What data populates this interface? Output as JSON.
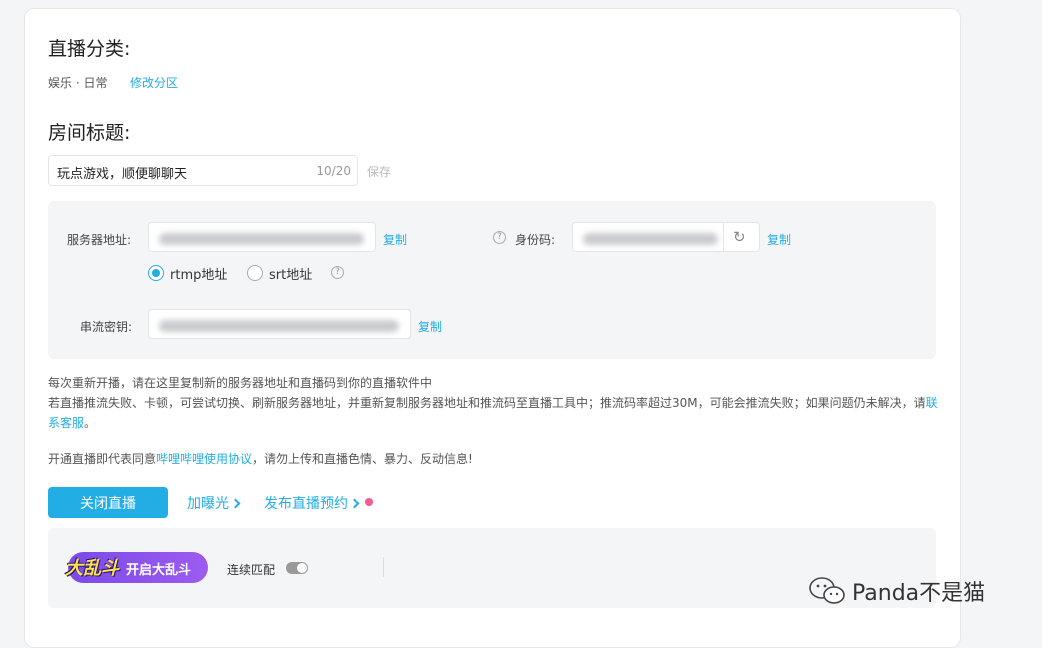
{
  "category": {
    "title": "直播分类:",
    "value": "娱乐 · 日常",
    "change_link": "修改分区"
  },
  "room_title": {
    "title": "房间标题:",
    "input_value": "玩点游戏，顺便聊聊天",
    "counter": "10/20",
    "save_label": "保存"
  },
  "stream": {
    "server_label": "服务器地址:",
    "server_copy": "复制",
    "idcode_label": "身份码:",
    "idcode_copy": "复制",
    "protocol_rtmp": "rtmp地址",
    "protocol_srt": "srt地址",
    "protocol_selected": "rtmp地址",
    "key_label": "串流密钥:",
    "key_copy": "复制"
  },
  "notes": {
    "line1": "每次重新开播，请在这里复制新的服务器地址和直播码到你的直播软件中",
    "line2_text": "若直播推流失败、卡顿，可尝试切换、刷新服务器地址，并重新复制服务器地址和推流码至直播工具中；推流码率超过30M，可能会推流失败；如果问题仍未解决，请",
    "line2_link_a": "联",
    "line2_link_b": "系客服",
    "line2_end": "。"
  },
  "agreement": {
    "prefix": "开通直播即代表同意",
    "link": "哔哩哔哩使用协议",
    "suffix": "，请勿上传和直播色情、暴力、反动信息!"
  },
  "actions": {
    "close_live": "关闭直播",
    "boost": "加曝光",
    "schedule": "发布直播预约"
  },
  "brawl": {
    "logo_text": "大乱斗",
    "button_text": "开启大乱斗",
    "continuous_label": "连续匹配",
    "continuous_on": false
  },
  "watermark": {
    "text": "Panda不是猫"
  },
  "colors": {
    "accent": "#23ade5",
    "badge_dot": "#f25d8e",
    "brawl_purple": "#8a52ec"
  }
}
